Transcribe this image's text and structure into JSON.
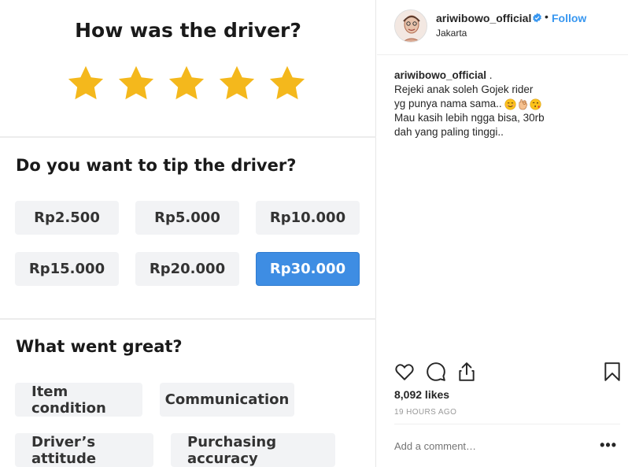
{
  "rating": {
    "title": "How was the driver?",
    "stars_filled": 5,
    "stars_total": 5,
    "star_color": "#f4b81c"
  },
  "tip": {
    "title": "Do you want to tip the driver?",
    "options": [
      "Rp2.500",
      "Rp5.000",
      "Rp10.000",
      "Rp15.000",
      "Rp20.000",
      "Rp30.000"
    ],
    "selected": "Rp30.000",
    "selected_color": "#3e8de3"
  },
  "great": {
    "title": "What went great?",
    "chips": [
      "Item condition",
      "Communication",
      "Driver’s attitude",
      "Purchasing accuracy"
    ]
  },
  "post": {
    "username": "ariwibowo_official",
    "separator": "•",
    "follow_label": "Follow",
    "location": "Jakarta",
    "caption_user": "ariwibowo_official",
    "caption_after_user": " .",
    "caption_line1": "Rejeki anak soleh Gojek rider",
    "caption_line2": "yg punya nama sama..",
    "caption_line3": "Mau kasih lebih ngga bisa, 30rb",
    "caption_line4": "dah yang paling tinggi..",
    "caption_emojis": [
      "smiling-face-emoji",
      "ok-hand-emoji",
      "face-blowing-kiss-emoji"
    ],
    "likes": "8,092 likes",
    "time": "19 HOURS AGO",
    "comment_placeholder": "Add a comment…",
    "more_label": "•••",
    "accent_color": "#3897f0"
  }
}
